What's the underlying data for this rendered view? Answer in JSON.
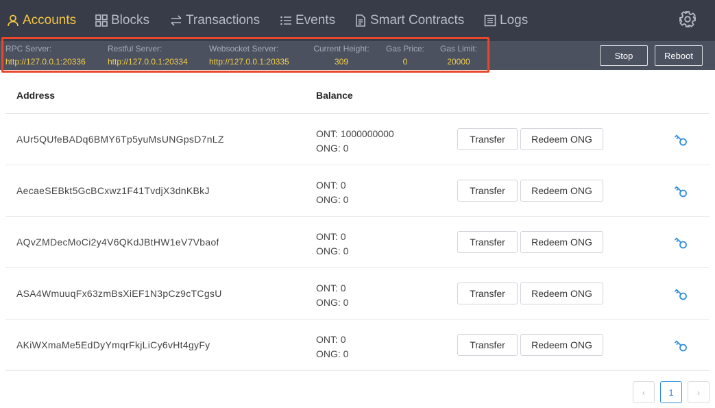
{
  "nav": {
    "items": [
      {
        "label": "Accounts",
        "icon": "user-icon",
        "active": true
      },
      {
        "label": "Blocks",
        "icon": "grid-icon"
      },
      {
        "label": "Transactions",
        "icon": "swap-icon"
      },
      {
        "label": "Events",
        "icon": "list-icon"
      },
      {
        "label": "Smart Contracts",
        "icon": "file-icon"
      },
      {
        "label": "Logs",
        "icon": "log-icon"
      }
    ],
    "settings_icon": "gear-icon"
  },
  "server": {
    "rpc": {
      "label": "RPC Server:",
      "value": "http://127.0.0.1:20336"
    },
    "restful": {
      "label": "Restful Server:",
      "value": "http://127.0.0.1:20334"
    },
    "websocket": {
      "label": "Websocket Server:",
      "value": "http://127.0.0.1:20335"
    },
    "height": {
      "label": "Current Height:",
      "value": "309"
    },
    "gas_price": {
      "label": "Gas Price:",
      "value": "0"
    },
    "gas_limit": {
      "label": "Gas Limit:",
      "value": "20000"
    },
    "stop_label": "Stop",
    "reboot_label": "Reboot"
  },
  "table": {
    "headers": {
      "address": "Address",
      "balance": "Balance"
    },
    "transfer_label": "Transfer",
    "redeem_label": "Redeem ONG",
    "rows": [
      {
        "address": "AUr5QUfeBADq6BMY6Tp5yuMsUNGpsD7nLZ",
        "ont": "ONT: 1000000000",
        "ong": "ONG: 0"
      },
      {
        "address": "AecaeSEBkt5GcBCxwz1F41TvdjX3dnKBkJ",
        "ont": "ONT: 0",
        "ong": "ONG: 0"
      },
      {
        "address": "AQvZMDecMoCi2y4V6QKdJBtHW1eV7Vbaof",
        "ont": "ONT: 0",
        "ong": "ONG: 0"
      },
      {
        "address": "ASA4WmuuqFx63zmBsXiEF1N3pCz9cTCgsU",
        "ont": "ONT: 0",
        "ong": "ONG: 0"
      },
      {
        "address": "AKiWXmaMe5EdDyYmqrFkjLiCy6vHt4gyFy",
        "ont": "ONT: 0",
        "ong": "ONG: 0"
      }
    ],
    "row_icon": "key-icon"
  },
  "pagination": {
    "prev": "‹",
    "current": "1",
    "next": "›"
  },
  "colors": {
    "nav_bg": "#373c48",
    "active": "#f5c542",
    "info_bg": "#4c5160",
    "value": "#f2cf4a",
    "highlight": "#e8472a",
    "link_blue": "#2f8ee0"
  }
}
